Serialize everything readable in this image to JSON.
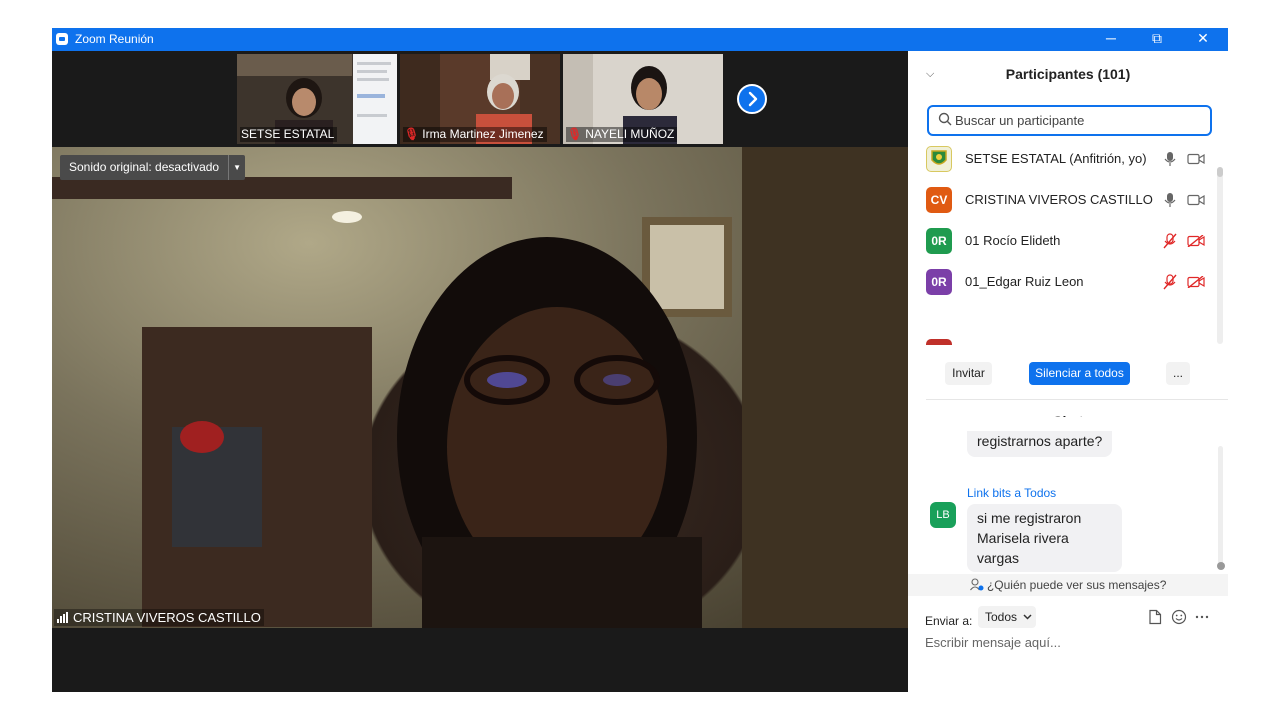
{
  "window": {
    "title": "Zoom Reunión",
    "minimize": "─",
    "restore": "⧉",
    "close": "✕"
  },
  "gallery": [
    {
      "name": "SETSE ESTATAL",
      "muted": false
    },
    {
      "name": "Irma Martinez Jimenez",
      "muted": true
    },
    {
      "name": "NAYELI MUÑOZ",
      "muted": true
    }
  ],
  "main_video": {
    "sound_label": "Sonido original: desactivado",
    "speaker_name": "CRISTINA VIVEROS CASTILLO"
  },
  "participants": {
    "title": "Participantes (101)",
    "search_placeholder": "Buscar un participante",
    "list": [
      {
        "initials": "",
        "name": "SETSE ESTATAL (Anfitrión, yo)",
        "color": "#e9d86a",
        "mic": "on",
        "video": "on"
      },
      {
        "initials": "CV",
        "name": "CRISTINA VIVEROS CASTILLO",
        "color": "#e05a12",
        "mic": "on",
        "video": "on"
      },
      {
        "initials": "0R",
        "name": "01 Rocío Elideth",
        "color": "#1f9b4f",
        "mic": "off",
        "video": "off"
      },
      {
        "initials": "0R",
        "name": "01_Edgar Ruiz Leon",
        "color": "#7b3fa8",
        "mic": "off",
        "video": "off"
      }
    ],
    "invite_label": "Invitar",
    "mute_all_label": "Silenciar a todos",
    "more_label": "..."
  },
  "chat": {
    "title": "Chat",
    "prev_message": "registrarnos aparte?",
    "message": {
      "avatar": "LB",
      "sender": "Link bits a Todos",
      "line1": "si me registraron",
      "line2": "Marisela rivera vargas"
    },
    "who_can_see": "¿Quién puede ver sus mensajes?",
    "send_to_label": "Enviar a:",
    "send_to_value": "Todos",
    "input_placeholder": "Escribir mensaje aquí..."
  },
  "colors": {
    "accent": "#0e72ed",
    "muted_red": "#e02828"
  }
}
